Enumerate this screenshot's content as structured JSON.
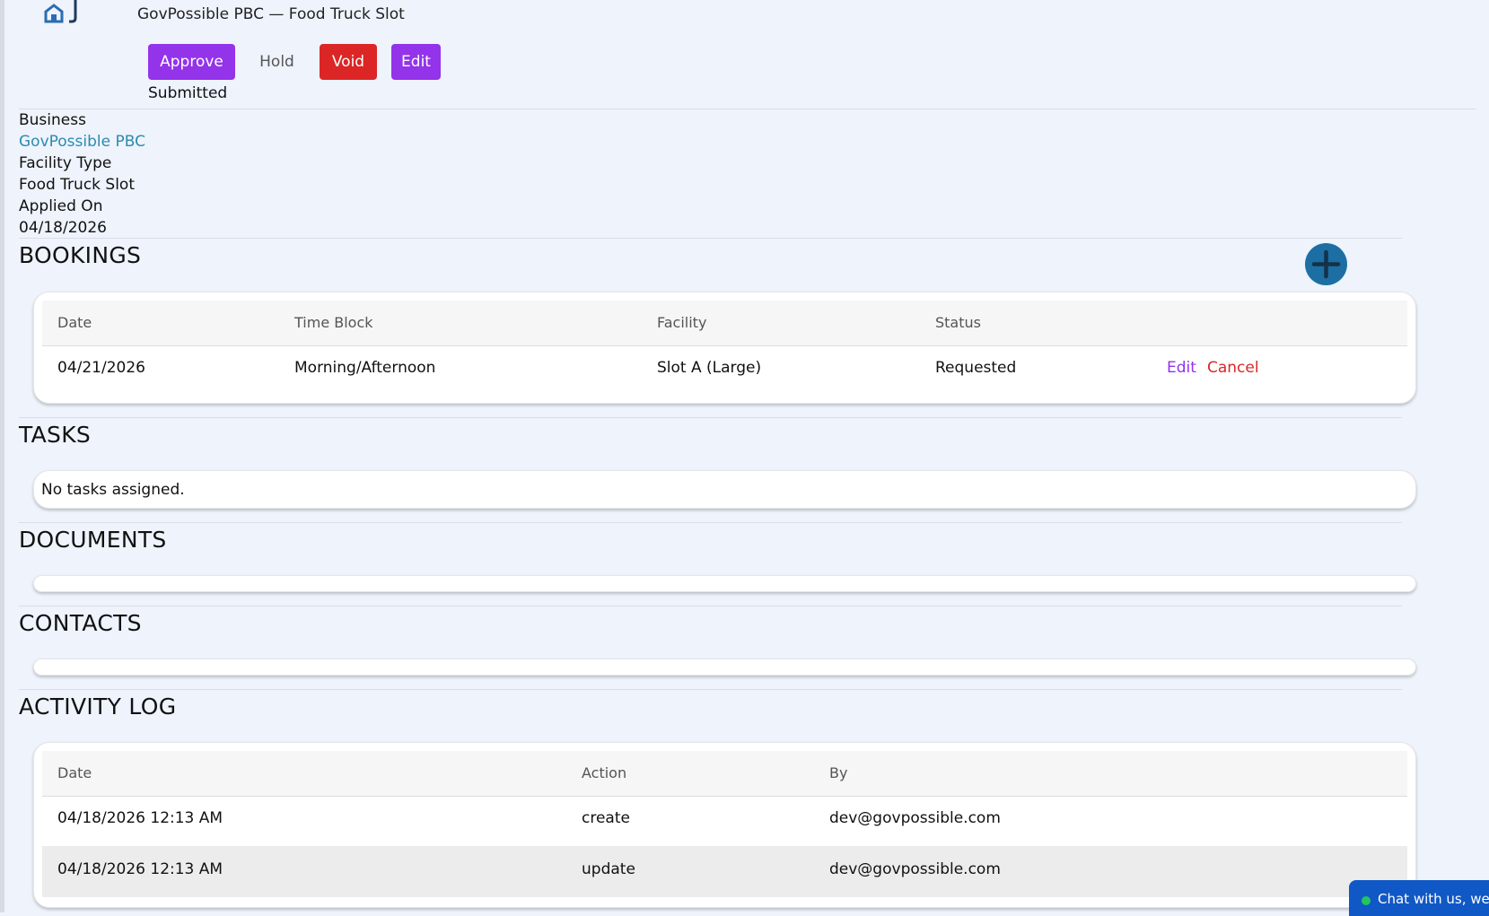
{
  "header": {
    "title": "GovPossible PBC — Food Truck Slot",
    "status": "Submitted"
  },
  "actions": {
    "approve": "Approve",
    "hold": "Hold",
    "void": "Void",
    "edit": "Edit"
  },
  "details": {
    "business_label": "Business",
    "business_value": "GovPossible PBC",
    "facility_type_label": "Facility Type",
    "facility_type_value": "Food Truck Slot",
    "applied_on_label": "Applied On",
    "applied_on_value": "04/18/2026"
  },
  "bookings": {
    "heading": "BOOKINGS",
    "columns": [
      "Date",
      "Time Block",
      "Facility",
      "Status"
    ],
    "rows": [
      {
        "date": "04/21/2026",
        "time_block": "Morning/Afternoon",
        "facility": "Slot A (Large)",
        "status": "Requested",
        "edit": "Edit",
        "cancel": "Cancel"
      }
    ]
  },
  "tasks": {
    "heading": "TASKS",
    "empty": "No tasks assigned."
  },
  "documents": {
    "heading": "DOCUMENTS"
  },
  "contacts": {
    "heading": "CONTACTS"
  },
  "activity_log": {
    "heading": "ACTIVITY LOG",
    "columns": [
      "Date",
      "Action",
      "By"
    ],
    "rows": [
      {
        "date": "04/18/2026 12:13 AM",
        "action": "create",
        "by": "dev@govpossible.com"
      },
      {
        "date": "04/18/2026 12:13 AM",
        "action": "update",
        "by": "dev@govpossible.com"
      }
    ]
  },
  "chat": {
    "label": "Chat with us, we are"
  },
  "colors": {
    "purple": "#9333ea",
    "red": "#dc2626",
    "link_blue": "#2b8bb0",
    "add_button": "#1d6fa3",
    "chat_blue": "#1058c5"
  },
  "icons": [
    "home-icon",
    "plus-icon",
    "online-dot-icon"
  ]
}
